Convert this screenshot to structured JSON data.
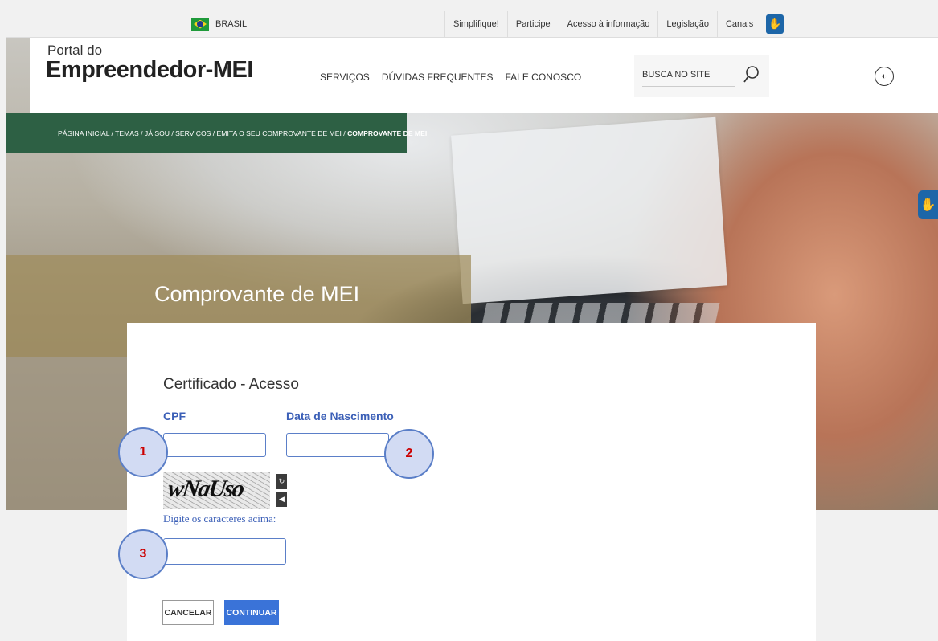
{
  "govbar": {
    "country": "BRASIL",
    "links": [
      "Simplifique!",
      "Participe",
      "Acesso à informação",
      "Legislação",
      "Canais"
    ],
    "accessibility_icon": "hand-sign-icon"
  },
  "header": {
    "logo_top": "Portal do",
    "logo_main": "Empreendedor-MEI",
    "nav": [
      "SERVIÇOS",
      "DÚVIDAS FREQUENTES",
      "FALE CONOSCO"
    ],
    "search_placeholder": "BUSCA NO SITE",
    "contrast_icon": "contrast-icon"
  },
  "breadcrumb": {
    "path": "PÁGINA INICIAL / TEMAS / JÁ SOU / SERVIÇOS / EMITA O SEU COMPROVANTE DE MEI / ",
    "current": "COMPROVANTE DE MEI"
  },
  "hero": {
    "title": "Comprovante de MEI"
  },
  "form": {
    "title": "Certificado - Acesso",
    "cpf_label": "CPF",
    "cpf_value": "",
    "dob_label": "Data de Nascimento",
    "dob_value": "",
    "captcha_text": "wNaUso",
    "captcha_hint": "Digite os caracteres acima:",
    "captcha_value": "",
    "cancel": "CANCELAR",
    "continue": "CONTINUAR"
  },
  "annotations": [
    "1",
    "2",
    "3"
  ],
  "colors": {
    "green_breadcrumb": "#2d6044",
    "primary_blue": "#3a73d8",
    "label_blue": "#3b5fb7",
    "bubble_fill": "#d2dbf3",
    "bubble_number": "#cc0000"
  }
}
